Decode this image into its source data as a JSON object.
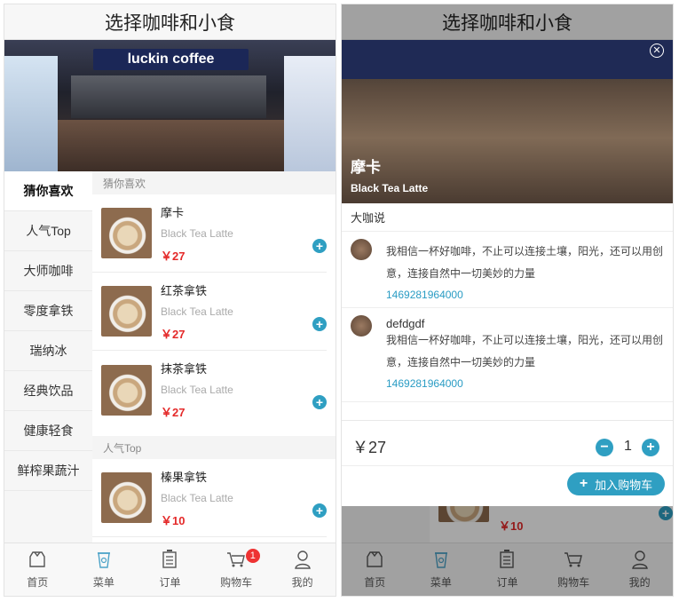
{
  "screen_title": "选择咖啡和小食",
  "banner": {
    "sign": "luckin coffee"
  },
  "categories": [
    "猜你喜欢",
    "人气Top",
    "大师咖啡",
    "零度拿铁",
    "瑞纳冰",
    "经典饮品",
    "健康轻食",
    "鲜榨果蔬汁"
  ],
  "sections": [
    {
      "title": "猜你喜欢",
      "items": [
        {
          "name": "摩卡",
          "sub": "Black Tea Latte",
          "price": "￥27"
        },
        {
          "name": "红茶拿铁",
          "sub": "Black Tea Latte",
          "price": "￥27"
        },
        {
          "name": "抹茶拿铁",
          "sub": "Black Tea Latte",
          "price": "￥27"
        }
      ]
    },
    {
      "title": "人气Top",
      "items": [
        {
          "name": "榛果拿铁",
          "sub": "Black Tea Latte",
          "price": "￥10"
        }
      ]
    }
  ],
  "tabbar": [
    {
      "label": "首页",
      "icon": "home-icon"
    },
    {
      "label": "菜单",
      "icon": "menu-cup-icon"
    },
    {
      "label": "订单",
      "icon": "order-icon"
    },
    {
      "label": "购物车",
      "icon": "cart-icon",
      "badge": "1"
    },
    {
      "label": "我的",
      "icon": "user-icon"
    }
  ],
  "modal": {
    "name": "摩卡",
    "sub": "Black Tea Latte",
    "section_title": "大咖说",
    "comments": [
      {
        "user": "",
        "text": "我相信一杯好咖啡，不止可以连接土壤，阳光，还可以用创意，连接自然中一切美妙的力量",
        "timestamp": "1469281964000"
      },
      {
        "user": "defdgdf",
        "text": "我相信一杯好咖啡，不止可以连接土壤，阳光，还可以用创意，连接自然中一切美妙的力量",
        "timestamp": "1469281964000"
      }
    ],
    "price": "￥27",
    "quantity": "1",
    "add_to_cart": "加入购物车"
  },
  "colors": {
    "accent": "#2f9fc2",
    "price": "#e42a2a",
    "badge": "#e33333"
  }
}
